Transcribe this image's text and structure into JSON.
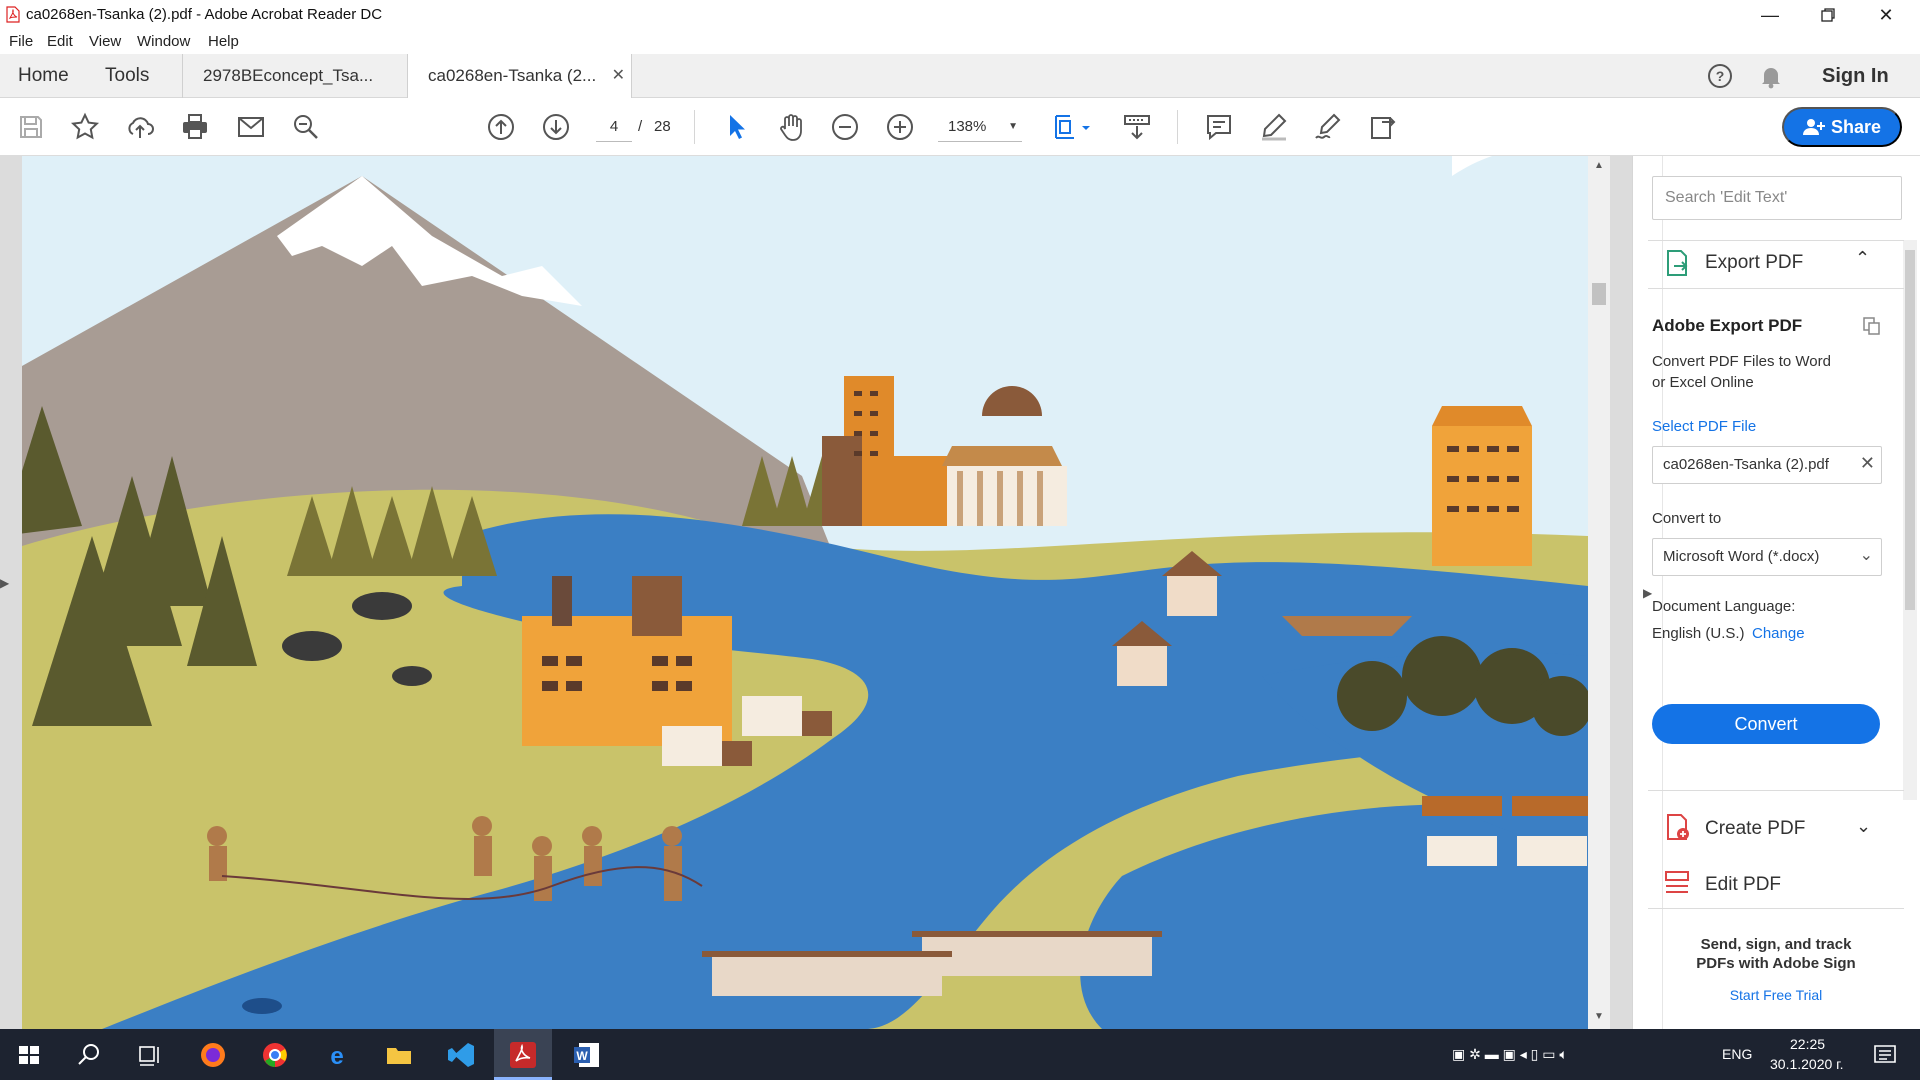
{
  "window": {
    "title": "ca0268en-Tsanka (2).pdf - Adobe Acrobat Reader DC"
  },
  "menu": [
    "File",
    "Edit",
    "View",
    "Window",
    "Help"
  ],
  "tabs": {
    "home": "Home",
    "tools": "Tools",
    "doc1": "2978BEconcept_Tsa...",
    "doc2": "ca0268en-Tsanka (2...",
    "sign_in": "Sign In"
  },
  "toolbar": {
    "page_current": "4",
    "page_sep": "/",
    "page_total": "28",
    "zoom": "138%",
    "share": "Share"
  },
  "right_pane": {
    "search_placeholder": "Search 'Edit Text'",
    "export_title": "Export PDF",
    "section_title": "Adobe Export PDF",
    "section_desc_1": "Convert PDF Files to Word",
    "section_desc_2": "or Excel Online",
    "select_label": "Select PDF File",
    "file_name": "ca0268en-Tsanka (2).pdf",
    "convert_to_label": "Convert to",
    "convert_to_value": "Microsoft Word (*.docx)",
    "doc_lang_label": "Document Language:",
    "doc_lang_value": "English (U.S.)",
    "change_link": "Change",
    "convert_button": "Convert",
    "create_pdf": "Create PDF",
    "edit_pdf": "Edit PDF",
    "sign_promo_1": "Send, sign, and track",
    "sign_promo_2": "PDFs with Adobe Sign",
    "free_trial": "Start Free Trial"
  },
  "taskbar": {
    "lang": "ENG",
    "time": "22:25",
    "date": "30.1.2020 г."
  },
  "colors": {
    "accent": "#1473e6",
    "taskbar": "#1d2330",
    "water": "#3b7fc4",
    "land": "#c9c36a",
    "sky": "#dff0f8"
  }
}
